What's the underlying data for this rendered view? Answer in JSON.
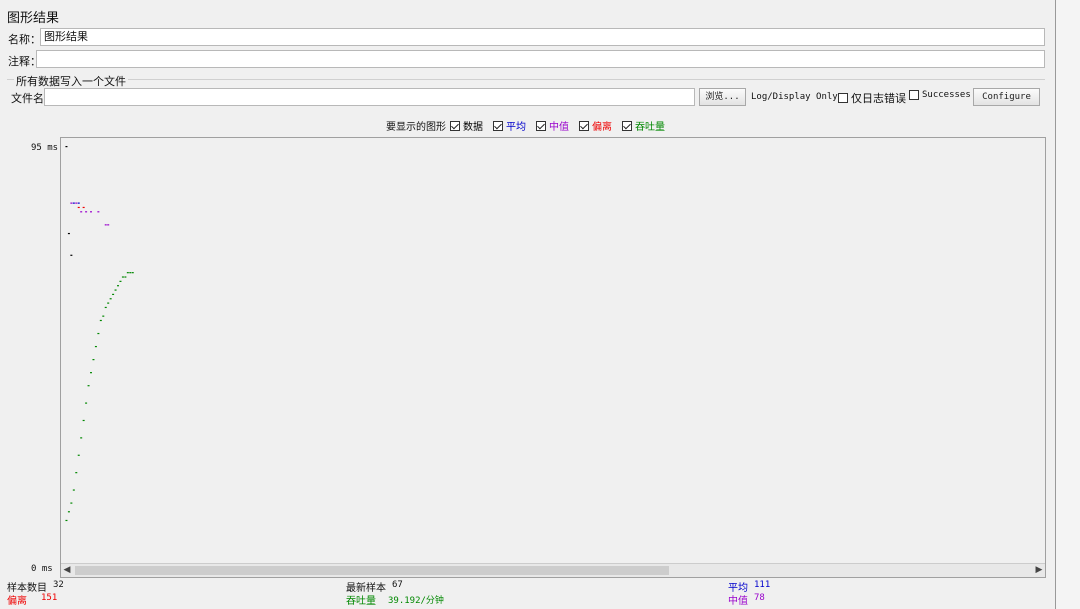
{
  "panel": {
    "title": "图形结果"
  },
  "name_row": {
    "label": "名称：",
    "value": "图形结果"
  },
  "comment_row": {
    "label": "注释：",
    "value": ""
  },
  "file_group": {
    "title": "所有数据写入一个文件",
    "file_label": "文件名",
    "file_value": "",
    "browse_label": "浏览...",
    "log_display_label": "Log/Display Only:",
    "errors_only_label": "仅日志错误",
    "errors_only_checked": false,
    "successes_label": "Successes",
    "successes_checked": false,
    "configure_label": "Configure"
  },
  "display_options": {
    "label": "要显示的图形",
    "items": [
      {
        "key": "data",
        "label": "数据",
        "checked": true,
        "color": "#000000"
      },
      {
        "key": "average",
        "label": "平均",
        "checked": true,
        "color": "#0000cc"
      },
      {
        "key": "median",
        "label": "中值",
        "checked": true,
        "color": "#9900cc"
      },
      {
        "key": "deviation",
        "label": "偏离",
        "checked": true,
        "color": "#ee0000"
      },
      {
        "key": "throughput",
        "label": "吞吐量",
        "checked": true,
        "color": "#008800"
      }
    ]
  },
  "chart_data": {
    "type": "scatter",
    "y_max_label": "95 ms",
    "y_min_label": "0 ms",
    "ylim": [
      0,
      95
    ],
    "xlim": [
      0,
      400
    ],
    "series": [
      {
        "name": "数据",
        "color": "#000000",
        "points": [
          [
            1,
            95
          ],
          [
            2,
            75
          ],
          [
            3,
            70
          ]
        ]
      },
      {
        "name": "平均",
        "color": "#0000cc",
        "points": [
          [
            4,
            82
          ],
          [
            6,
            82
          ]
        ]
      },
      {
        "name": "中值",
        "color": "#9900cc",
        "points": [
          [
            3,
            82
          ],
          [
            5,
            82
          ],
          [
            7,
            80
          ],
          [
            9,
            80
          ],
          [
            11,
            80
          ],
          [
            14,
            80
          ],
          [
            17,
            77
          ],
          [
            18,
            77
          ]
        ]
      },
      {
        "name": "偏离",
        "color": "#ee0000",
        "points": [
          [
            6,
            81
          ],
          [
            8,
            81
          ]
        ]
      },
      {
        "name": "吞吐量",
        "color": "#008800",
        "points": [
          [
            1,
            9
          ],
          [
            2,
            11
          ],
          [
            3,
            13
          ],
          [
            4,
            16
          ],
          [
            5,
            20
          ],
          [
            6,
            24
          ],
          [
            7,
            28
          ],
          [
            8,
            32
          ],
          [
            9,
            36
          ],
          [
            10,
            40
          ],
          [
            11,
            43
          ],
          [
            12,
            46
          ],
          [
            13,
            49
          ],
          [
            14,
            52
          ],
          [
            15,
            55
          ],
          [
            16,
            56
          ],
          [
            17,
            58
          ],
          [
            18,
            59
          ],
          [
            19,
            60
          ],
          [
            20,
            61
          ],
          [
            21,
            62
          ],
          [
            22,
            63
          ],
          [
            23,
            64
          ],
          [
            24,
            65
          ],
          [
            25,
            65
          ],
          [
            26,
            66
          ],
          [
            27,
            66
          ],
          [
            28,
            66
          ]
        ]
      }
    ]
  },
  "stats": {
    "sample_count_label": "样本数目",
    "sample_count": "32",
    "latest_sample_label": "最新样本",
    "latest_sample": "67",
    "average_label": "平均",
    "average": "111",
    "deviation_label": "偏离",
    "deviation": "151",
    "throughput_label": "吞吐量",
    "throughput": "39.192/分钟",
    "median_label": "中值",
    "median": "78"
  },
  "colors": {
    "average": "#0000cc",
    "median": "#9900cc",
    "deviation": "#ee0000",
    "throughput": "#008800"
  }
}
